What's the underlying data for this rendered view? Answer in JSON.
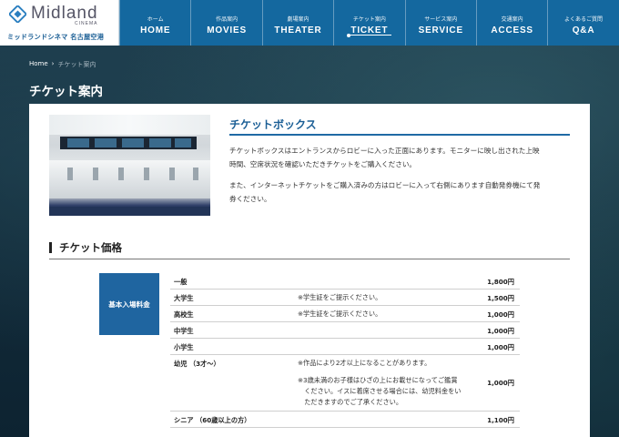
{
  "brand": {
    "logo_word": "Midland",
    "logo_sub": "CINEMA",
    "logo_jp": "ミッドランドシネマ 名古屋空港"
  },
  "nav": [
    {
      "jp": "ホーム",
      "en": "HOME"
    },
    {
      "jp": "作品案内",
      "en": "MOVIES"
    },
    {
      "jp": "劇場案内",
      "en": "THEATER"
    },
    {
      "jp": "チケット案内",
      "en": "TICKET"
    },
    {
      "jp": "サービス案内",
      "en": "SERVICE"
    },
    {
      "jp": "交通案内",
      "en": "ACCESS"
    },
    {
      "jp": "よくあるご質問",
      "en": "Q&A"
    }
  ],
  "breadcrumb": {
    "home": "Home",
    "sep": "›",
    "current": "チケット案内"
  },
  "page_title": "チケット案内",
  "ticket_box": {
    "title": "チケットボックス",
    "para1_line1": "チケットボックスはエントランスからロビーに入った正面にあります。モニターに映し出された上映",
    "para1_line2": "時間、空席状況を確認いただきチケットをご購入ください。",
    "para2_line1": "また、インターネットチケットをご購入済みの方はロビーに入って右側にあります自動発券機にて発",
    "para2_line2": "券ください。"
  },
  "pricing": {
    "section_title": "チケット価格",
    "label": "基本入場料金",
    "rows": [
      {
        "category": "一般",
        "note": "",
        "price": "1,800円"
      },
      {
        "category": "大学生",
        "note": "※学生証をご提示ください。",
        "price": "1,500円"
      },
      {
        "category": "高校生",
        "note": "※学生証をご提示ください。",
        "price": "1,000円"
      },
      {
        "category": "中学生",
        "note": "",
        "price": "1,000円"
      },
      {
        "category": "小学生",
        "note": "",
        "price": "1,000円"
      },
      {
        "category": "幼児 （3才〜）",
        "note": "※作品により2才以上になることがあります。",
        "note2_line1": "※3歳未満のお子様はひざの上にお載せになってご鑑賞",
        "note2_line2": "　ください。イスに着席させる場合には、幼児料金をい",
        "note2_line3": "　ただきますのでご了承ください。",
        "price": "1,000円"
      },
      {
        "category": "シニア （60歳以上の方）",
        "note": "",
        "price": "1,100円"
      }
    ]
  },
  "colors": {
    "header_blue": "#14689f",
    "accent_blue": "#1f65a0"
  }
}
